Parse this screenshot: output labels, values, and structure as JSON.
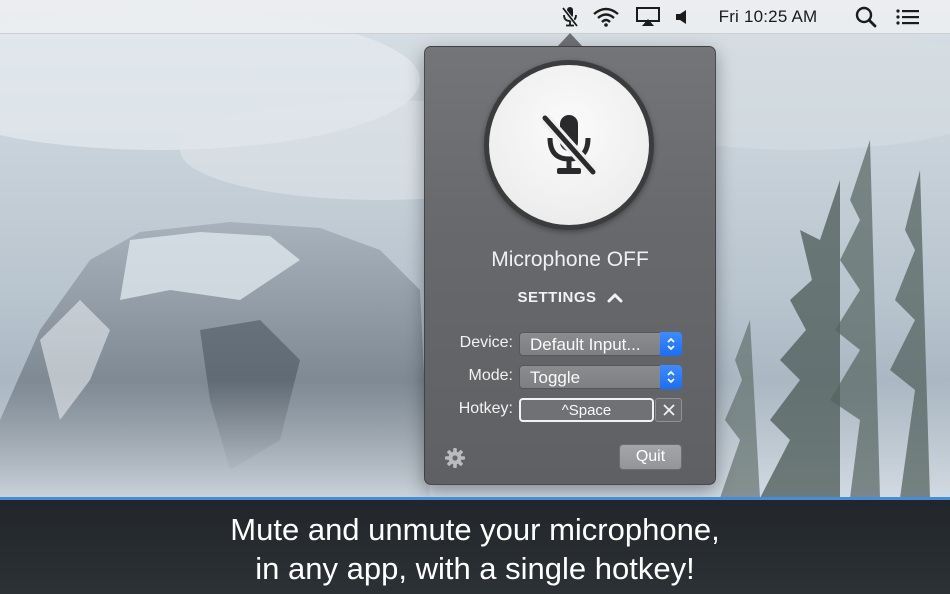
{
  "menubar": {
    "icons": [
      "mic-muted-icon",
      "wifi-icon",
      "airplay-icon",
      "volume-icon",
      "search-icon",
      "notification-center-icon"
    ],
    "clock": "Fri 10:25 AM"
  },
  "popover": {
    "mic_button_icon": "mic-muted-icon",
    "status": "Microphone OFF",
    "settings_label": "SETTINGS",
    "device": {
      "label": "Device:",
      "value": "Default Input..."
    },
    "mode": {
      "label": "Mode:",
      "value": "Toggle"
    },
    "hotkey": {
      "label": "Hotkey:",
      "value": "^Space"
    },
    "gear_icon": "gear-icon",
    "quit_label": "Quit"
  },
  "caption": {
    "line1": "Mute and unmute your microphone,",
    "line2": "in any app, with a single hotkey!"
  },
  "colors": {
    "accent": "#1a6ff5",
    "caption_border": "#3f8fe0",
    "popover_bg": "#67696c"
  }
}
